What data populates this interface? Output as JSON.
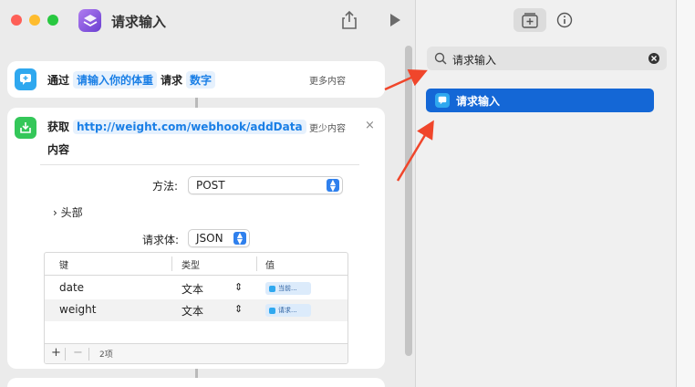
{
  "window": {
    "title": "请求输入"
  },
  "ask_action": {
    "prefix": "通过",
    "prompt": "请输入你的体重",
    "middle": "请求",
    "type": "数字",
    "more": "更多内容"
  },
  "fetch_action": {
    "prefix": "获取",
    "url": "http://weight.com/webhook/addData",
    "suffix": "内容",
    "less": "更少内容",
    "close": "×",
    "method_label": "方法:",
    "method_value": "POST",
    "headers_label": "头部",
    "body_label": "请求体:",
    "body_value": "JSON",
    "table": {
      "columns": [
        "键",
        "类型",
        "值"
      ],
      "rows": [
        {
          "key": "date",
          "type": "文本",
          "value": "当前..."
        },
        {
          "key": "weight",
          "type": "文本",
          "value": "请求..."
        }
      ],
      "add": "+",
      "remove": "−",
      "count": "2项"
    }
  },
  "sidebar": {
    "search_value": "请求输入",
    "results": [
      "请求输入"
    ]
  },
  "colors": {
    "accent": "#1467d6",
    "token_blue": "#1a7fe6",
    "action_blue": "#2fa8ef",
    "action_green": "#34c759",
    "arrow_red": "#f0462b"
  }
}
